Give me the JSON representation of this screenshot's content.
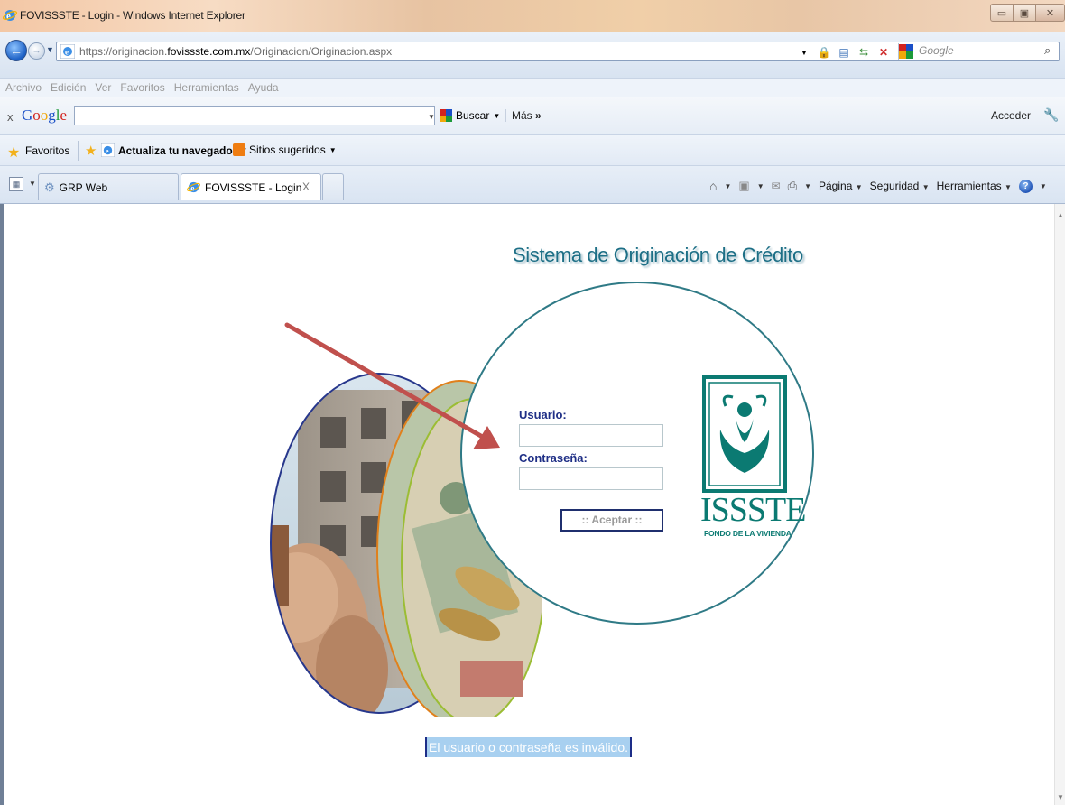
{
  "window": {
    "title": "FOVISSSTE - Login - Windows Internet Explorer"
  },
  "address_bar": {
    "url_prefix": "https://originacion.",
    "url_host": "fovissste.com.mx",
    "url_path": "/Originacion/Originacion.aspx",
    "search_placeholder": "Google"
  },
  "menu": [
    "Archivo",
    "Edición",
    "Ver",
    "Favoritos",
    "Herramientas",
    "Ayuda"
  ],
  "google_toolbar": {
    "close": "x",
    "search_button": "Buscar",
    "more": "Más",
    "signin": "Acceder"
  },
  "favorites_bar": {
    "favorites": "Favoritos",
    "update_browser": "Actualiza tu navegador",
    "suggested_sites": "Sitios sugeridos"
  },
  "tabs": [
    {
      "label": "GRP Web",
      "active": false
    },
    {
      "label": "FOVISSSTE - Login",
      "active": true
    }
  ],
  "command_bar": {
    "page": "Página",
    "security": "Seguridad",
    "tools": "Herramientas"
  },
  "page": {
    "title": "Sistema de Originación de Crédito",
    "user_label": "Usuario:",
    "password_label": "Contraseña:",
    "accept_button": ":: Aceptar ::",
    "logo_name": "ISSSTE",
    "logo_subtitle": "FONDO DE LA VIVIENDA",
    "error_message": "El usuario o contraseña es inválido."
  },
  "colors": {
    "title_teal": "#1d6f86",
    "label_navy": "#1f2f86",
    "logo_green": "#0b7a72",
    "error_bg": "#a8d0f0",
    "annotation_arrow": "#c0504d"
  }
}
